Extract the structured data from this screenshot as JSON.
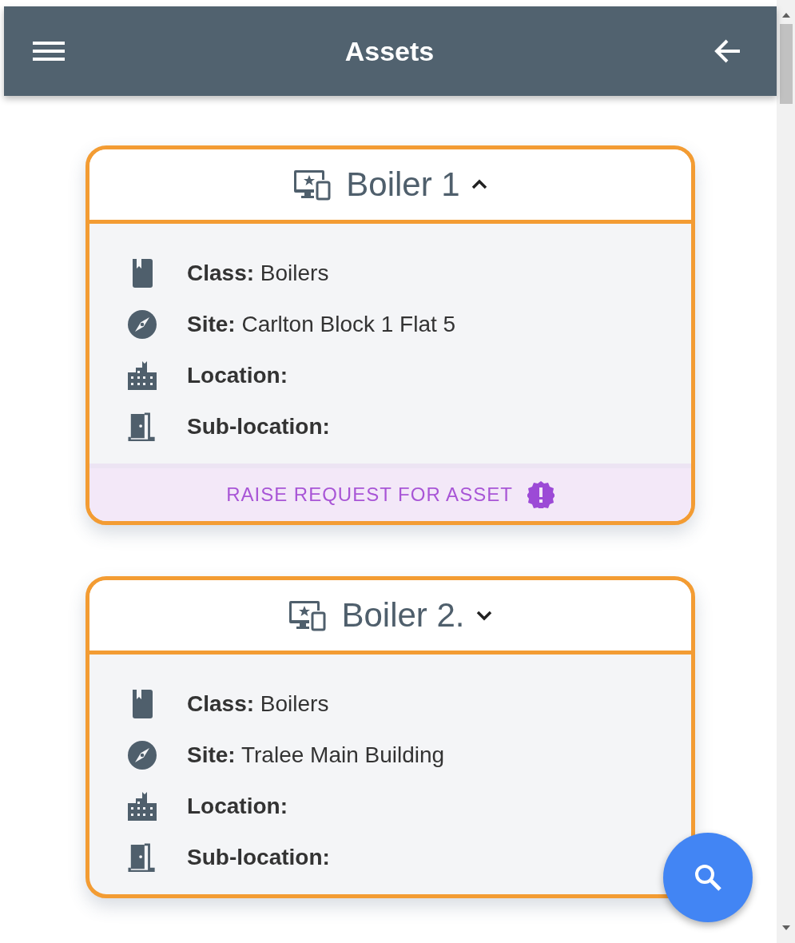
{
  "app_bar": {
    "title": "Assets"
  },
  "cards": [
    {
      "title": "Boiler 1",
      "expanded": true,
      "fields": [
        {
          "kind": "class",
          "label": "Class:",
          "value": "Boilers"
        },
        {
          "kind": "site",
          "label": "Site:",
          "value": "Carlton Block 1 Flat 5"
        },
        {
          "kind": "location",
          "label": "Location:"
        },
        {
          "kind": "sublocation",
          "label": "Sub-location:"
        }
      ],
      "action": "RAISE REQUEST FOR ASSET"
    },
    {
      "title": "Boiler 2.",
      "expanded": false,
      "fields": [
        {
          "kind": "class",
          "label": "Class:",
          "value": "Boilers"
        },
        {
          "kind": "site",
          "label": "Site:",
          "value": "Tralee Main Building"
        },
        {
          "kind": "location",
          "label": "Location:"
        },
        {
          "kind": "sublocation",
          "label": "Sub-location:"
        }
      ]
    }
  ]
}
